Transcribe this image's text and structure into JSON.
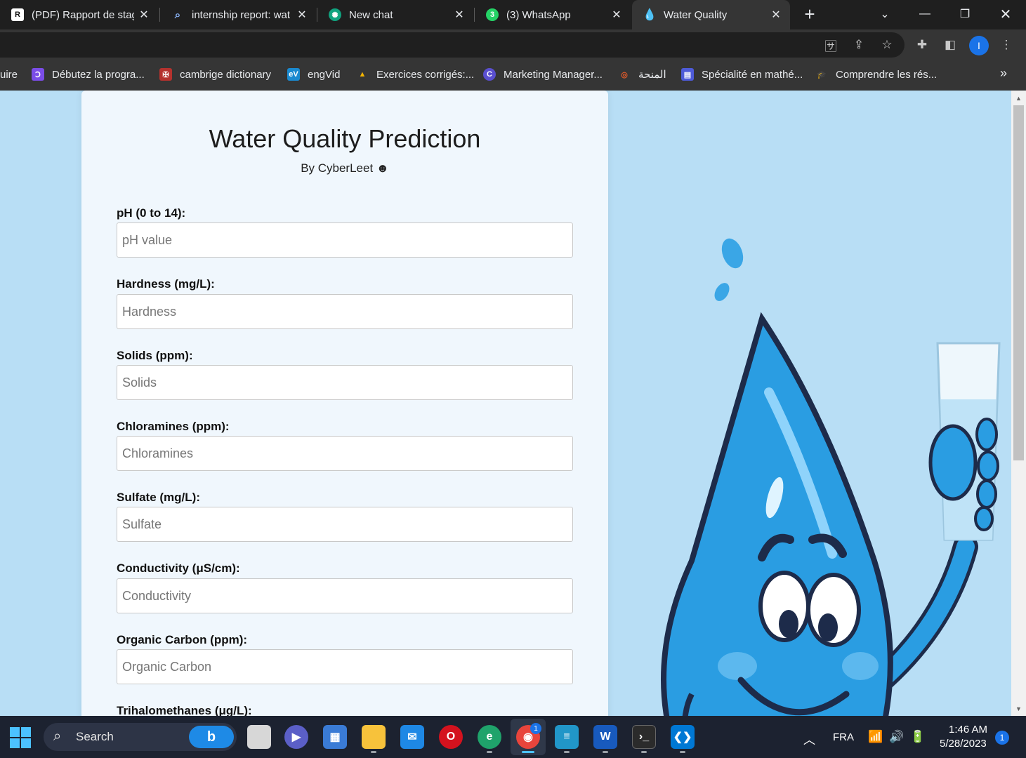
{
  "browser": {
    "tabs": [
      {
        "title": "(PDF) Rapport de stag",
        "icon": "researchgate-icon",
        "active": false
      },
      {
        "title": "internship report: wat",
        "icon": "search-icon",
        "active": false
      },
      {
        "title": "New chat",
        "icon": "chatgpt-icon",
        "active": false
      },
      {
        "title": "(3) WhatsApp",
        "icon": "whatsapp-icon",
        "active": false
      },
      {
        "title": "Water Quality",
        "icon": "water-drop-icon",
        "active": true
      }
    ],
    "bookmarks": [
      {
        "label": "uire"
      },
      {
        "label": "Débutez la progra..."
      },
      {
        "label": "cambrige dictionary"
      },
      {
        "label": "engVid"
      },
      {
        "label": "Exercices corrigés:..."
      },
      {
        "label": "Marketing Manager..."
      },
      {
        "label": "المنحة"
      },
      {
        "label": "Spécialité en mathé..."
      },
      {
        "label": "Comprendre les rés..."
      }
    ],
    "profile_initial": "I"
  },
  "page": {
    "title": "Water Quality Prediction",
    "byline": "By CyberLeet ☻",
    "fields": [
      {
        "label": "pH (0 to 14):",
        "placeholder": "pH value"
      },
      {
        "label": "Hardness (mg/L):",
        "placeholder": "Hardness"
      },
      {
        "label": "Solids (ppm):",
        "placeholder": "Solids"
      },
      {
        "label": "Chloramines (ppm):",
        "placeholder": "Chloramines"
      },
      {
        "label": "Sulfate (mg/L):",
        "placeholder": "Sulfate"
      },
      {
        "label": "Conductivity (μS/cm):",
        "placeholder": "Conductivity"
      },
      {
        "label": "Organic Carbon (ppm):",
        "placeholder": "Organic Carbon"
      },
      {
        "label": "Trihalomethanes (μg/L):",
        "placeholder": ""
      }
    ]
  },
  "taskbar": {
    "search_label": "Search",
    "language": "FRA",
    "time": "1:46 AM",
    "date": "5/28/2023",
    "notification_count": "1",
    "chrome_badge": "1"
  }
}
